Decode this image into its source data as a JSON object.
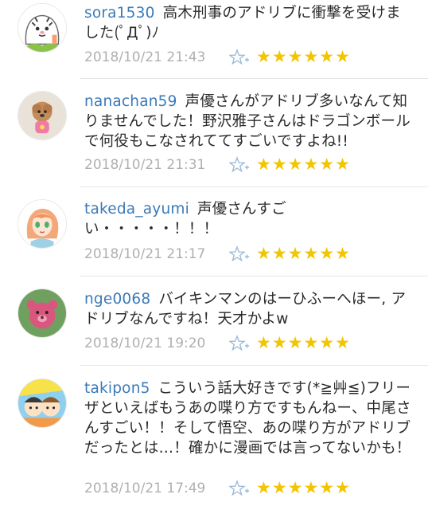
{
  "comments": [
    {
      "username": "sora1530",
      "text": "高木刑事のアドリブに衝撃を受けました(ﾟДﾟ)ﾉ",
      "timestamp": "2018/10/21 21:43",
      "stars": "★★★★★★",
      "avatar_icon": "tiger-avatar"
    },
    {
      "username": "nanachan59",
      "text": "声優さんがアドリブ多いなんて知りませんでした！野沢雅子さんはドラゴンボールで何役もこなされててすごいですよね!!",
      "timestamp": "2018/10/21 21:31",
      "stars": "★★★★★★",
      "avatar_icon": "poodle-avatar"
    },
    {
      "username": "takeda_ayumi",
      "text": "声優さんすごい・・・・・！！！",
      "timestamp": "2018/10/21 21:17",
      "stars": "★★★★★★",
      "avatar_icon": "anime-girl-avatar"
    },
    {
      "username": "nge0068",
      "text": "バイキンマンのはーひふーへほー, アドリブなんですね！天才かよw",
      "timestamp": "2018/10/21 19:20",
      "stars": "★★★★★★",
      "avatar_icon": "pink-bear-avatar"
    },
    {
      "username": "takipon5",
      "text": "こういう話大好きです(*≧艸≦)フリーザといえばもうあの喋り方ですもんねー、中尾さんすごい！！そして悟空、あの喋り方がアドリブだったとは…！確かに漫画では言ってないかも！",
      "timestamp": "2018/10/21 17:49",
      "stars": "★★★★★★",
      "avatar_icon": "cartoon-kids-avatar"
    }
  ],
  "colors": {
    "username": "#3a7ab8",
    "star": "#f2c500",
    "meta": "#b0b0b0",
    "text": "#2b2b2b"
  }
}
